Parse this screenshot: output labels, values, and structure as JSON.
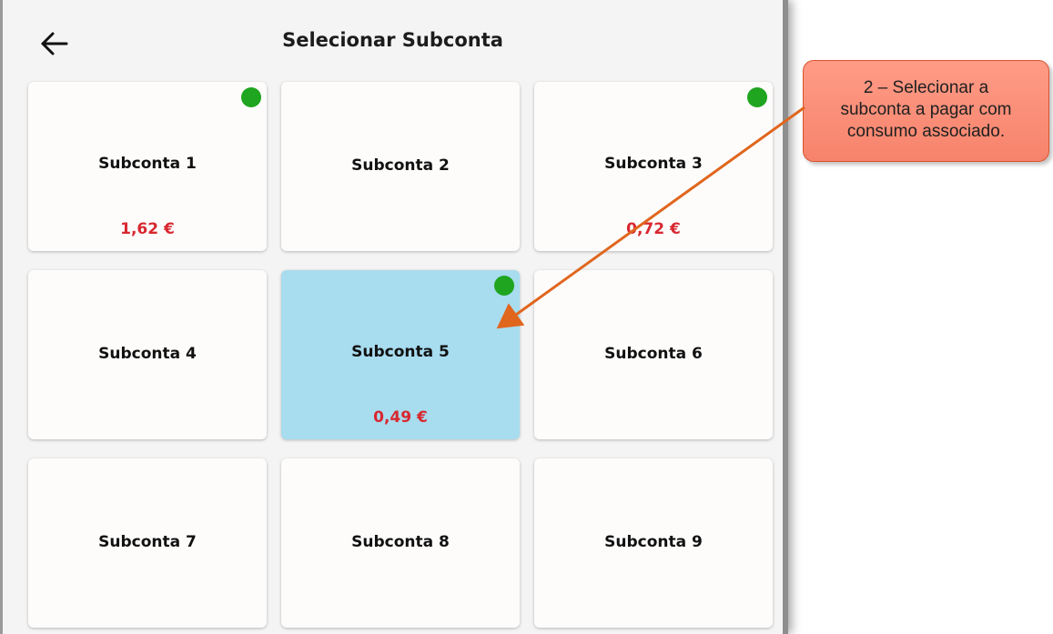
{
  "header": {
    "title": "Selecionar Subconta",
    "back_icon": "arrow-left-icon"
  },
  "subaccounts": [
    {
      "name": "Subconta 1",
      "amount": "1,62 €",
      "active": true,
      "selected": false
    },
    {
      "name": "Subconta 2",
      "amount": "",
      "active": false,
      "selected": false
    },
    {
      "name": "Subconta 3",
      "amount": "0,72 €",
      "active": true,
      "selected": false
    },
    {
      "name": "Subconta 4",
      "amount": "",
      "active": false,
      "selected": false
    },
    {
      "name": "Subconta 5",
      "amount": "0,49 €",
      "active": true,
      "selected": true
    },
    {
      "name": "Subconta 6",
      "amount": "",
      "active": false,
      "selected": false
    },
    {
      "name": "Subconta 7",
      "amount": "",
      "active": false,
      "selected": false
    },
    {
      "name": "Subconta 8",
      "amount": "",
      "active": false,
      "selected": false
    },
    {
      "name": "Subconta 9",
      "amount": "",
      "active": false,
      "selected": false
    }
  ],
  "annotation": {
    "lines": [
      "2 – Selecionar a",
      "subconta a pagar com",
      "consumo associado."
    ]
  },
  "colors": {
    "amount": "#d8272f",
    "active_dot": "#1fa51f",
    "selected_card": "#a8dcef",
    "callout_fill": "#f6836c",
    "arrow": "#e0661e"
  }
}
